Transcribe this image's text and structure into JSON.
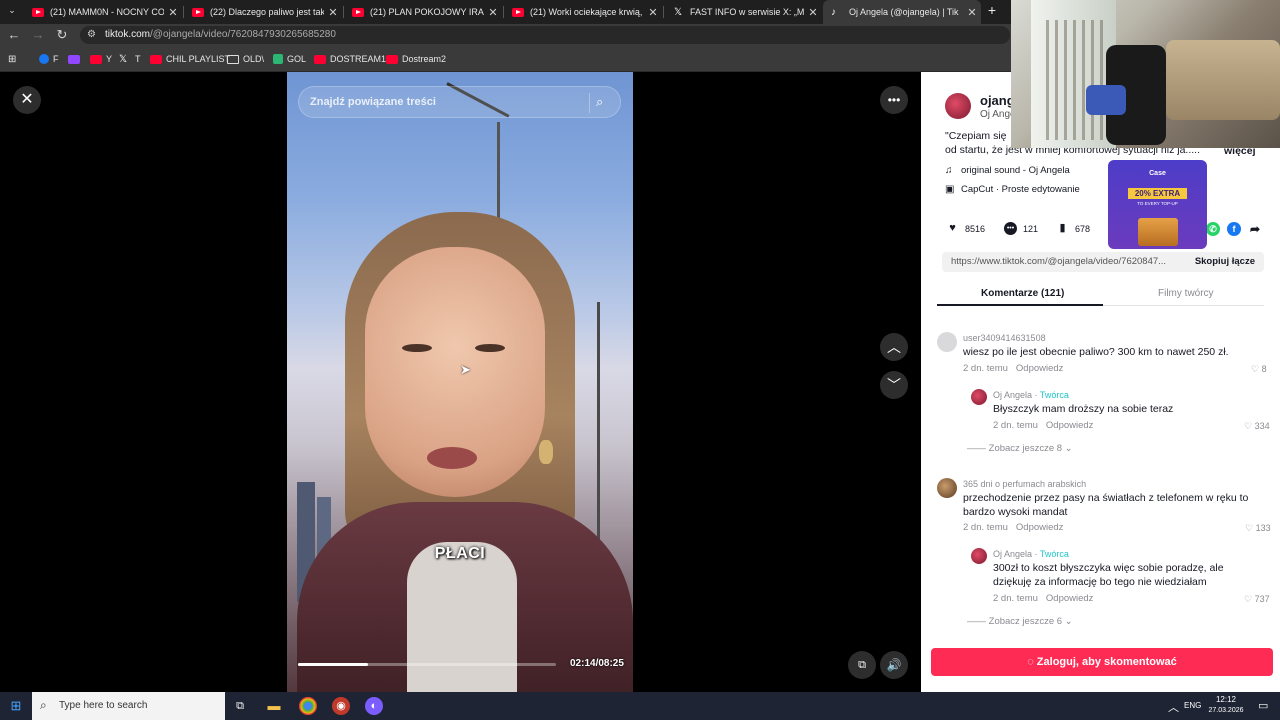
{
  "browser": {
    "tabs": [
      {
        "label": "(21) MAMM0N - NOCNY COUN",
        "icon": "youtube-icon"
      },
      {
        "label": "(22) Dlaczego paliwo jest takie",
        "icon": "youtube-icon"
      },
      {
        "label": "(21) PLAN POKOJOWY IRAN-U",
        "icon": "youtube-icon"
      },
      {
        "label": "(21) Worki ociekające krwią, a w",
        "icon": "youtube-icon"
      },
      {
        "label": "FAST INFO w serwisie X: „Minist",
        "icon": "x-icon"
      },
      {
        "label": "Oj Angela (@ojangela) | Tik",
        "icon": "tiktok-icon"
      }
    ],
    "new_tab": "+",
    "url_host": "tiktok.com",
    "url_path": "/@ojangela/video/7620847930265685280",
    "bookmarks": [
      {
        "label": "F",
        "icon": "facebook-icon"
      },
      {
        "label": "",
        "icon": "twitch-icon"
      },
      {
        "label": "Y",
        "icon": "youtube-icon"
      },
      {
        "label": "T",
        "icon": "x-icon"
      },
      {
        "label": "CHIL PLAYLIST",
        "icon": "youtube-icon"
      },
      {
        "label": "OLD\\",
        "icon": "folder-icon"
      },
      {
        "label": "GOL",
        "icon": "g-icon"
      },
      {
        "label": "DOSTREAM1",
        "icon": "youtube-icon"
      },
      {
        "label": "Dostream2",
        "icon": "youtube-icon"
      }
    ]
  },
  "video": {
    "search_placeholder": "Znajdź powiązane treści",
    "caption": "PŁACI",
    "time": "02:14/08:25",
    "progress": 0.27
  },
  "panel": {
    "creator_name": "ojang",
    "creator_nick": "Oj Ange",
    "desc_line1": "\"Czepiam się",
    "desc_line2": "od startu, że jest w mniej komfortowej sytuacji niż ja.....",
    "more": "więcej",
    "sound": "original sound - Oj Angela",
    "capcut": "CapCut · Proste edytowanie",
    "likes": "8516",
    "comments_count": "121",
    "saves": "678",
    "link": "https://www.tiktok.com/@ojangela/video/7620847...",
    "copy_label": "Skopiuj łącze",
    "tab_comments": "Komentarze (121)",
    "tab_videos": "Filmy twórcy",
    "login_label": "Zaloguj, aby skomentować"
  },
  "comments": [
    {
      "user": "user3409414631508",
      "text": "wiesz po ile jest obecnie paliwo? 300 km to nawet 250 zł.",
      "time": "2 dn. temu",
      "reply": "Odpowiedz",
      "likes": "8",
      "creator_reply": {
        "user": "Oj Angela",
        "badge": "Twórca",
        "text": "Błyszczyk mam droższy na sobie teraz",
        "time": "2 dn. temu",
        "reply": "Odpowiedz",
        "likes": "334"
      },
      "more": "Zobacz jeszcze 8"
    },
    {
      "user": "365 dni o perfumach arabskich",
      "text": "przechodzenie przez pasy na światłach z telefonem w ręku to bardzo wysoki mandat",
      "time": "2 dn. temu",
      "reply": "Odpowiedz",
      "likes": "133",
      "creator_reply": {
        "user": "Oj Angela",
        "badge": "Twórca",
        "text": "300zł to koszt błyszczyka więc sobie poradzę, ale dziękuję za informację bo tego nie wiedziałam",
        "time": "2 dn. temu",
        "reply": "Odpowiedz",
        "likes": "737"
      },
      "more": "Zobacz jeszcze 6"
    }
  ],
  "ad": {
    "brand": "Case",
    "headline": "20% EXTRA",
    "sub": "TO EVERY TOP-UP"
  },
  "taskbar": {
    "search_placeholder": "Type here to search",
    "lang": "ENG",
    "time": "12:12",
    "date": "27.03.2026"
  },
  "colors": {
    "accent": "#fe2c55",
    "creator_badge": "#20c5c9"
  }
}
